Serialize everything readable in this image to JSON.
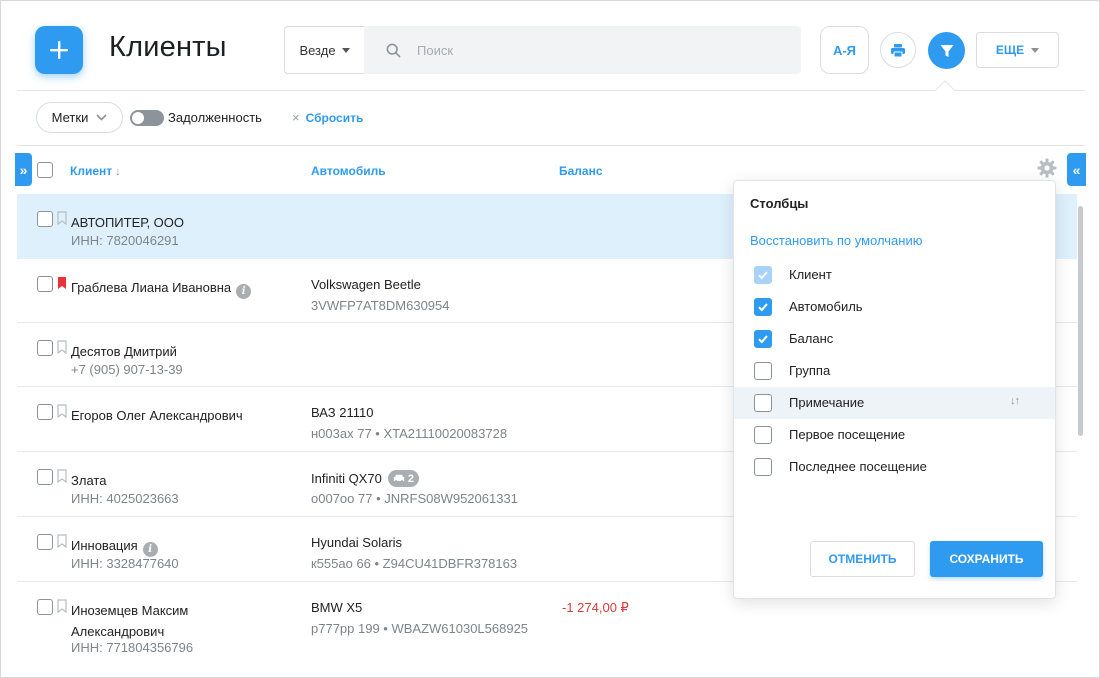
{
  "header": {
    "title": "Клиенты",
    "scope_label": "Везде",
    "search_placeholder": "Поиск",
    "sort_label": "А-Я",
    "more_label": "ЕЩЕ"
  },
  "filters": {
    "tags_label": "Метки",
    "debt_label": "Задолженность",
    "reset_label": "Сбросить"
  },
  "table": {
    "columns": {
      "client": "Клиент",
      "car": "Автомобиль",
      "balance": "Баланс"
    },
    "rows": [
      {
        "name": "АВТОПИТЕР, ООО",
        "sub": "ИНН: 7820046291",
        "car": "",
        "car_sub": "",
        "balance": ""
      },
      {
        "name": "Граблева Лиана Ивановна",
        "sub": "",
        "car": "Volkswagen Beetle",
        "car_sub": "3VWFP7AT8DM630954",
        "balance": ""
      },
      {
        "name": "Десятов Дмитрий",
        "sub": "+7 (905) 907-13-39",
        "car": "",
        "car_sub": "",
        "balance": ""
      },
      {
        "name": "Егоров Олег Александрович",
        "sub": "",
        "car": "ВАЗ 21110",
        "car_sub": "н003ах 77 • XTA21110020083728",
        "balance": ""
      },
      {
        "name": "Злата",
        "sub": "ИНН: 4025023663",
        "car": "Infiniti QX70",
        "car_badge": "2",
        "car_sub": "о007оо 77 • JNRFS08W952061331",
        "balance": ""
      },
      {
        "name": "Инновация",
        "sub": "ИНН: 3328477640",
        "car": "Hyundai Solaris",
        "car_sub": "к555ао 66 • Z94CU41DBFR378163",
        "balance": ""
      },
      {
        "name": "Иноземцев Максим Александрович",
        "sub": "ИНН: 771804356796",
        "car": "BMW X5",
        "car_sub": "р777рр 199 • WBAZW61030L568925",
        "balance": "-1 274,00 ₽"
      }
    ]
  },
  "columns_popup": {
    "title": "Столбцы",
    "restore_label": "Восстановить по умолчанию",
    "options": [
      {
        "label": "Клиент",
        "checked": true,
        "disabled": true
      },
      {
        "label": "Автомобиль",
        "checked": true
      },
      {
        "label": "Баланс",
        "checked": true
      },
      {
        "label": "Группа",
        "checked": false
      },
      {
        "label": "Примечание",
        "checked": false
      },
      {
        "label": "Первое посещение",
        "checked": false
      },
      {
        "label": "Последнее посещение",
        "checked": false
      }
    ],
    "cancel_label": "ОТМЕНИТЬ",
    "save_label": "СОХРАНИТЬ"
  },
  "colors": {
    "accent": "#2f9bf0",
    "negative": "#e03a3a",
    "bookmark_active": "#e8333a",
    "row_highlight": "#dff0fd"
  }
}
